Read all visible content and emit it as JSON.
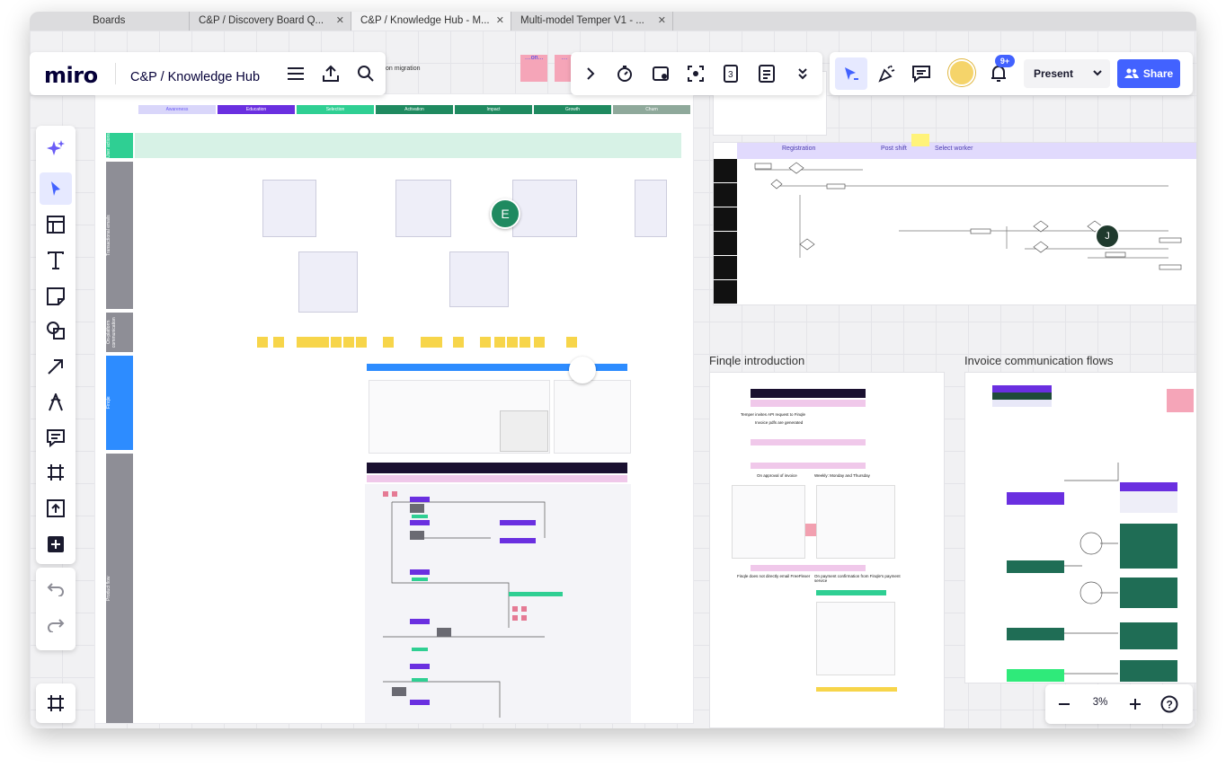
{
  "tabs": [
    {
      "label": "Boards",
      "active": false
    },
    {
      "label": "C&P / Discovery Board Q...",
      "active": false
    },
    {
      "label": "C&P / Knowledge Hub - M...",
      "active": true
    },
    {
      "label": "Multi-model Temper V1 - ...",
      "active": false
    }
  ],
  "header": {
    "logo": "miro",
    "board_title": "C&P / Knowledge Hub"
  },
  "board_text": {
    "migration_label": "on migration",
    "sticky_note_1": "…on...",
    "sticky_note_2": "…"
  },
  "right_toolbar": {
    "notification_count": "9+",
    "present_label": "Present",
    "share_label": "Share"
  },
  "zoom": {
    "level": "3%"
  },
  "avatars": {
    "e": "E",
    "j": "J"
  },
  "frames": {
    "finqle_title": "Finqle introduction",
    "invoice_title": "Invoice communication flows",
    "swimlane_col1": "Registration",
    "swimlane_col2": "Post shift",
    "swimlane_col3": "Select worker"
  },
  "journey": {
    "stages": [
      "Awareness",
      "Education",
      "Selection",
      "Activation",
      "Impact",
      "Growth",
      "Churn"
    ],
    "stage_colors": [
      "#d9d6fa",
      "#6a2fe0",
      "#2fcf93",
      "#1f8a60",
      "#1f8a60",
      "#1f8a60",
      "#8fa99b"
    ],
    "lanes": [
      "User actions",
      "Transactional emails",
      "On-platform communication",
      "Finqle",
      "Product flow"
    ]
  },
  "finqle_text": {
    "l1": "Temper invites API request to Finqle",
    "l2": "Invoice pdfs are generated",
    "l3": "On approval of invoice",
    "l4": "Weekly: Monday and Thursday",
    "l5": "Finqle does not directly email FreeFlexer",
    "l6": "On payment confirmation from Finqle's payment service"
  },
  "colors": {
    "accent": "#4262ff",
    "miro_dark": "#050038",
    "sticky": "#f7d54a",
    "journey_purple": "#6a2fe0",
    "journey_green": "#1f8a60"
  }
}
